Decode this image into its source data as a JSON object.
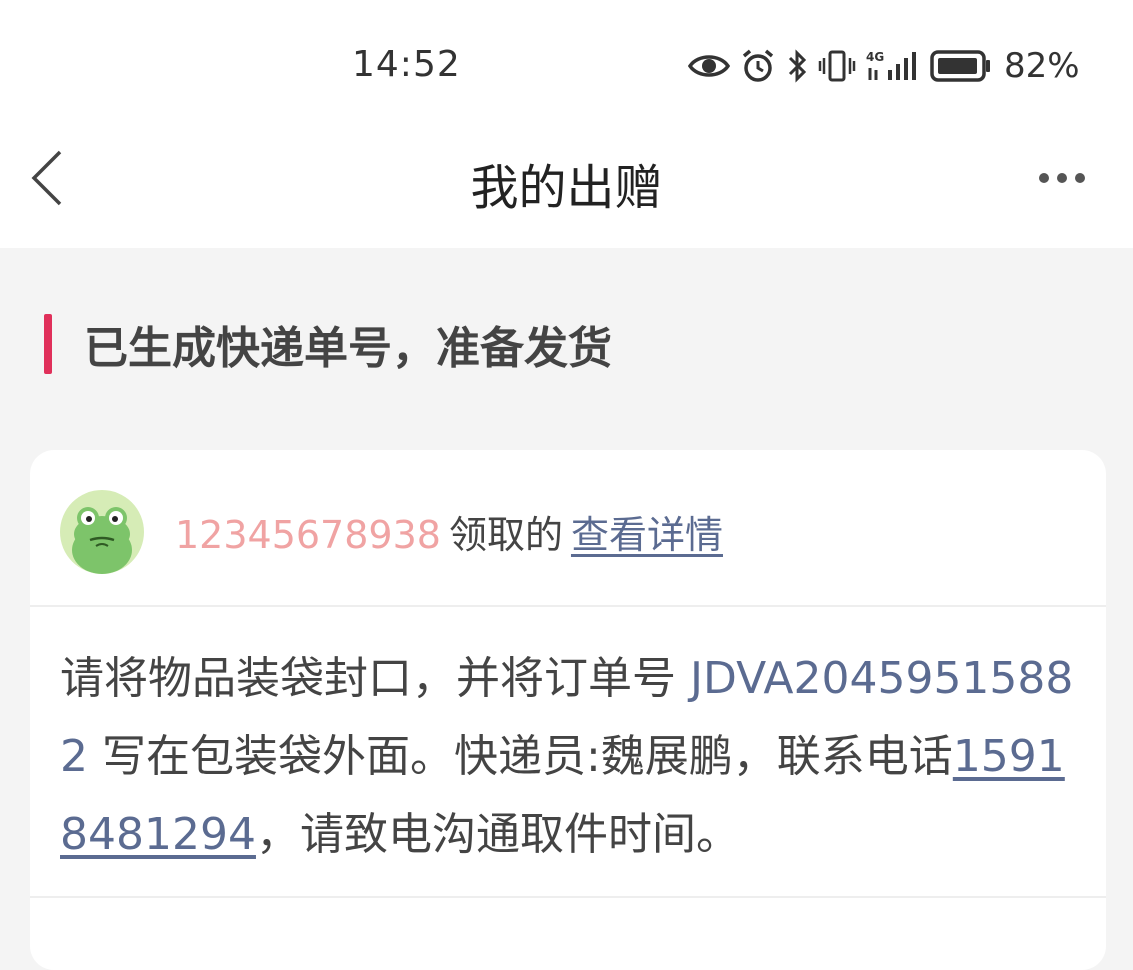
{
  "status_bar": {
    "time": "14:52",
    "icons": [
      "eye-icon",
      "alarm-icon",
      "bluetooth-icon",
      "vibrate-icon",
      "signal-4g-icon",
      "battery-icon"
    ],
    "battery_percent": "82%"
  },
  "nav": {
    "title": "我的出赠",
    "back_icon": "chevron-left-icon",
    "more_icon": "more-horizontal-icon"
  },
  "section": {
    "title": "已生成快递单号，准备发货",
    "accent_color": "#e0305a"
  },
  "card": {
    "avatar": "frog-avatar",
    "claimer_phone": "12345678938",
    "claim_text": "领取的",
    "details_link": "查看详情",
    "instructions": {
      "part1": "请将物品装袋封口，并将订单号 ",
      "order_number": "JDVA20459515882",
      "part2": " 写在包装袋外面。快递员:魏展鹏，联系电话",
      "courier_phone": "15918481294",
      "part3": "，请致电沟通取件时间。"
    }
  },
  "colors": {
    "link": "#5b6b91",
    "phone_highlight": "#f0a3a3",
    "background": "#f4f4f4"
  }
}
